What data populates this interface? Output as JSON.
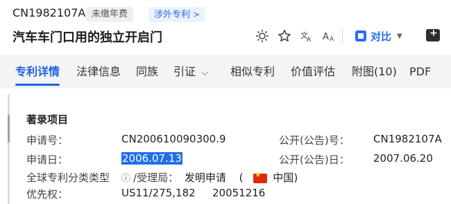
{
  "header": {
    "pub_number": "CN1982107A",
    "badge_fee": "未缴年费",
    "badge_foreign": "涉外专利",
    "title": "汽车车门口用的独立开启门",
    "compare_label": "对比"
  },
  "tabs": [
    {
      "label": "专利详情"
    },
    {
      "label": "法律信息"
    },
    {
      "label": "同族"
    },
    {
      "label": "引证"
    },
    {
      "label": "相似专利"
    },
    {
      "label": "价值评估"
    },
    {
      "label": "附图(10)"
    },
    {
      "label": "PDF"
    }
  ],
  "section": {
    "title": "著录项目",
    "app_no_label": "申请号：",
    "app_no": "CN200610090300.9",
    "pub_no_label": "公开(公告)号：",
    "pub_no": "CN1982107A",
    "app_date_label": "申请日：",
    "app_date": "2006.07.13",
    "pub_date_label": "公开(公告)日：",
    "pub_date": "2007.06.20",
    "classification_label": "全球专利分类类型",
    "office_label": "/受理局：",
    "classification_value": "发明申请",
    "country": "中国",
    "priority_label": "优先权：",
    "priority_no": "US11/275,182",
    "priority_date": "20051216"
  }
}
